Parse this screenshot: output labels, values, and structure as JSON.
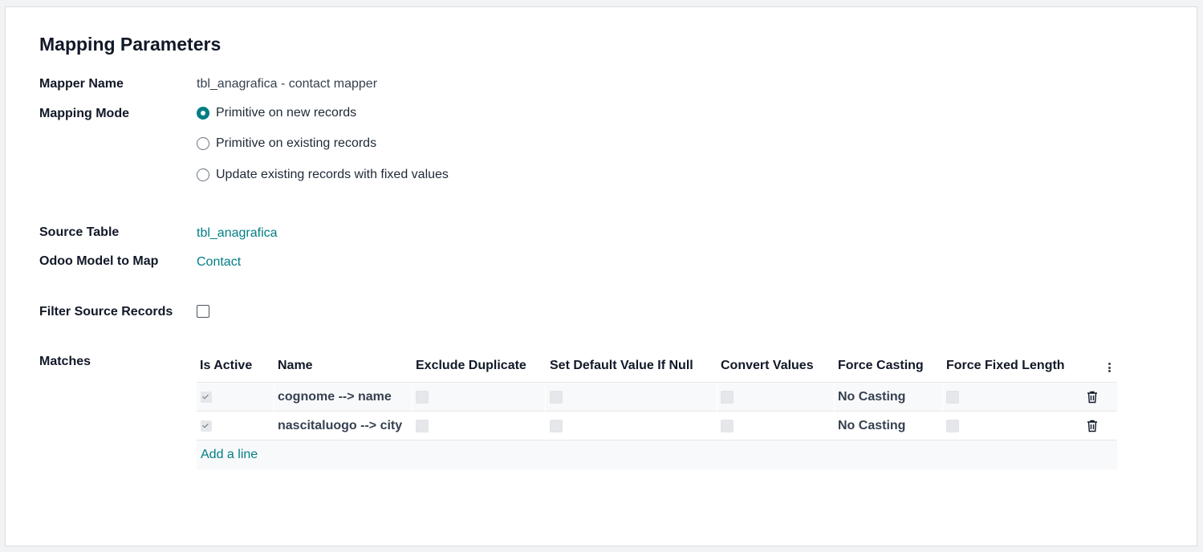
{
  "form": {
    "title": "Mapping Parameters",
    "mapper_name_label": "Mapper Name",
    "mapper_name_value": "tbl_anagrafica - contact mapper",
    "mapping_mode_label": "Mapping Mode",
    "mapping_mode_options": [
      {
        "label": "Primitive on new records",
        "selected": true
      },
      {
        "label": "Primitive on existing records",
        "selected": false
      },
      {
        "label": "Update existing records with fixed values",
        "selected": false
      }
    ],
    "source_table_label": "Source Table",
    "source_table_value": "tbl_anagrafica",
    "odoo_model_label": "Odoo Model to Map",
    "odoo_model_value": "Contact",
    "filter_source_label": "Filter Source Records",
    "filter_source_checked": false,
    "matches_label": "Matches"
  },
  "matches_table": {
    "columns": [
      "Is Active",
      "Name",
      "Exclude Duplicate",
      "Set Default Value If Null",
      "Convert Values",
      "Force Casting",
      "Force Fixed Length"
    ],
    "rows": [
      {
        "is_active": true,
        "name": "cognome --> name",
        "exclude_duplicate": false,
        "set_default": false,
        "convert_values": false,
        "force_casting": "No Casting",
        "force_fixed_length": false
      },
      {
        "is_active": true,
        "name": "nascitaluogo --> city",
        "exclude_duplicate": false,
        "set_default": false,
        "convert_values": false,
        "force_casting": "No Casting",
        "force_fixed_length": false
      }
    ],
    "add_line_label": "Add a line"
  },
  "icons": {
    "row_delete": "trash-icon",
    "column_options": "kebab-vertical-icon"
  },
  "colors": {
    "accent": "#017e84",
    "radio_selected": "#017e84"
  }
}
